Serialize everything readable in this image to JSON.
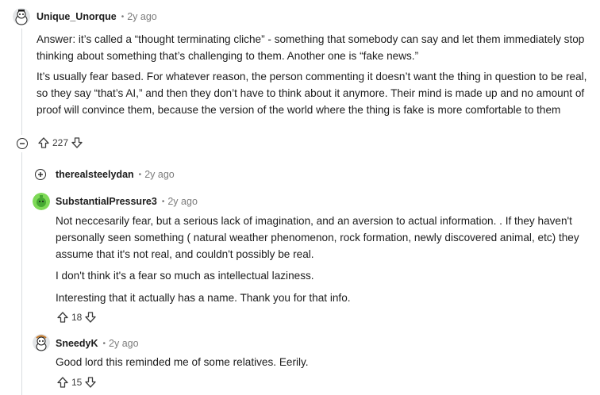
{
  "comments": [
    {
      "author": "Unique_Unorque",
      "time": "2y ago",
      "paragraphs": [
        "Answer: it’s called a “thought terminating cliche” - something that somebody can say and let them immediately stop thinking about something that’s challenging to them. Another one is “fake news.”",
        "It’s usually fear based. For whatever reason, the person commenting it doesn’t want the thing in question to be real, so they say “that’s AI,” and then they don’t have to think about it anymore. Their mind is made up and no amount of proof will convince them, because the version of the world where the thing is fake is more comfortable to them"
      ],
      "votes": "227"
    },
    {
      "author": "therealsteelydan",
      "time": "2y ago"
    },
    {
      "author": "SubstantialPressure3",
      "time": "2y ago",
      "paragraphs": [
        "Not neccesarily fear, but a serious lack of imagination, and an aversion to actual information. . If they haven't personally seen something ( natural weather phenomenon, rock formation, newly discovered animal, etc) they assume that it's not real, and couldn't possibly be real.",
        "I don't think it's a fear so much as intellectual laziness.",
        "Interesting that it actually has a name. Thank you for that info."
      ],
      "votes": "18"
    },
    {
      "author": "SneedyK",
      "time": "2y ago",
      "paragraphs": [
        "Good lord this reminded me of some relatives. Eerily."
      ],
      "votes": "15"
    }
  ],
  "separator": "•"
}
